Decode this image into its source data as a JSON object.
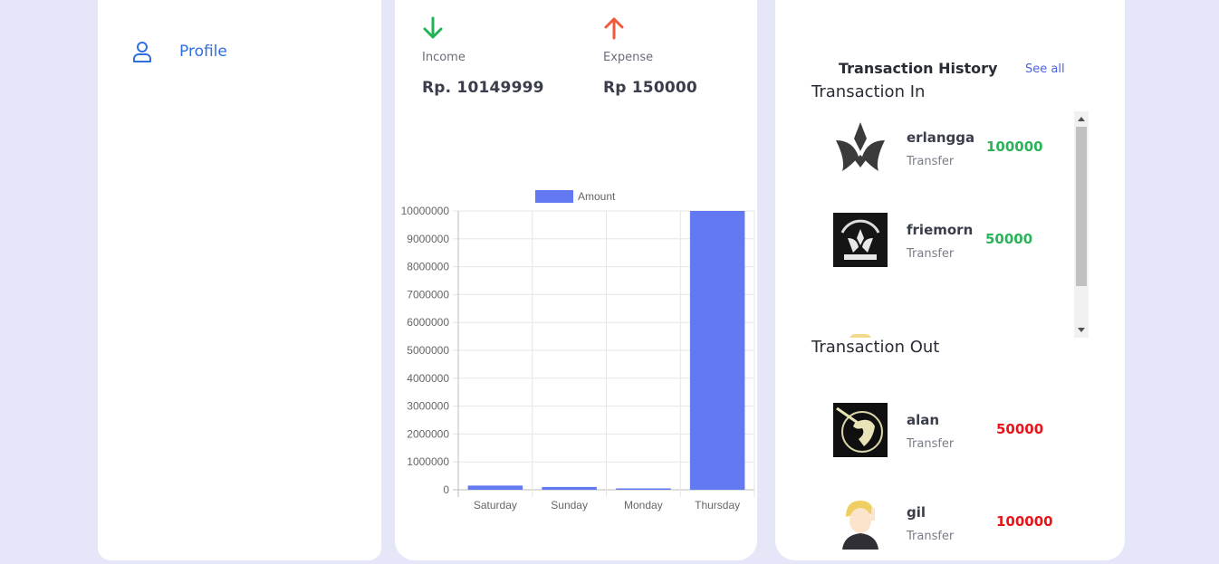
{
  "sidebar": {
    "items": [
      {
        "label": "Profile",
        "icon": "user-icon"
      }
    ]
  },
  "summary": {
    "income": {
      "label": "Income",
      "value": "Rp. 10149999",
      "icon": "arrow-down-icon",
      "color": "#23b357"
    },
    "expense": {
      "label": "Expense",
      "value": "Rp 150000",
      "icon": "arrow-up-icon",
      "color": "#f05a3a"
    }
  },
  "chart_data": {
    "type": "bar",
    "categories": [
      "Saturday",
      "Sunday",
      "Monday",
      "Thursday"
    ],
    "series": [
      {
        "name": "Amount",
        "values": [
          150000,
          100000,
          50000,
          10000000
        ],
        "color": "#6279f2"
      }
    ],
    "ylim": [
      0,
      10000000
    ],
    "yticks": [
      "0",
      "1000000",
      "2000000",
      "3000000",
      "4000000",
      "5000000",
      "6000000",
      "7000000",
      "8000000",
      "9000000",
      "10000000"
    ],
    "grid": true,
    "legend": "top"
  },
  "history": {
    "title": "Transaction History",
    "see_all": "See all",
    "in_title": "Transaction In",
    "out_title": "Transaction Out",
    "in": [
      {
        "name": "erlangga",
        "type": "Transfer",
        "amount": "100000"
      },
      {
        "name": "friemorn",
        "type": "Transfer",
        "amount": "50000"
      }
    ],
    "out": [
      {
        "name": "alan",
        "type": "Transfer",
        "amount": "50000"
      },
      {
        "name": "gil",
        "type": "Transfer",
        "amount": "100000"
      }
    ]
  }
}
